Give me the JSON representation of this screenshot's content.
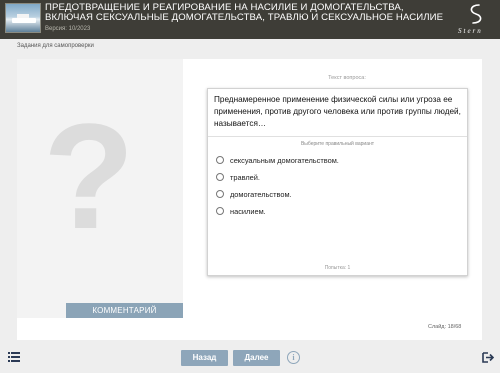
{
  "header": {
    "title_line1": "ПРЕДОТВРАЩЕНИЕ И РЕАГИРОВАНИЕ НА НАСИЛИЕ И ДОМОГАТЕЛЬСТВА,",
    "title_line2": "ВКЛЮЧАЯ СЕКСУАЛЬНЫЕ ДОМОГАТЕЛЬСТВА, ТРАВЛЮ И СЕКСУАЛЬНОЕ НАСИЛИЕ",
    "version": "Версия: 10/2023",
    "brand_text": "Stern",
    "brand_icon": "s-swirl-logo-icon"
  },
  "section_label": "Задания для самопроверки",
  "left_pane": {
    "placeholder_glyph": "?",
    "comment_button": "КОММЕНТАРИЙ"
  },
  "question": {
    "label": "Текст вопроса:",
    "text": "Преднамеренное применение физической силы или угроза ее применения, против другого человека или против группы людей, называется…",
    "choose_hint": "Выберите правильный вариант",
    "options": [
      "сексуальным домогательством.",
      "травлей.",
      "домогательством.",
      "насилием."
    ],
    "attempts": "Попытка: 1"
  },
  "slide_counter": "Слайд: 18/68",
  "footer": {
    "back_label": "Назад",
    "next_label": "Далее",
    "info_glyph": "i",
    "menu_icon": "menu-list-icon",
    "exit_icon": "exit-icon"
  },
  "colors": {
    "header_bg": "#3e3d37",
    "accent_button": "#8ea6ba",
    "page_bg": "#eeeeee"
  }
}
